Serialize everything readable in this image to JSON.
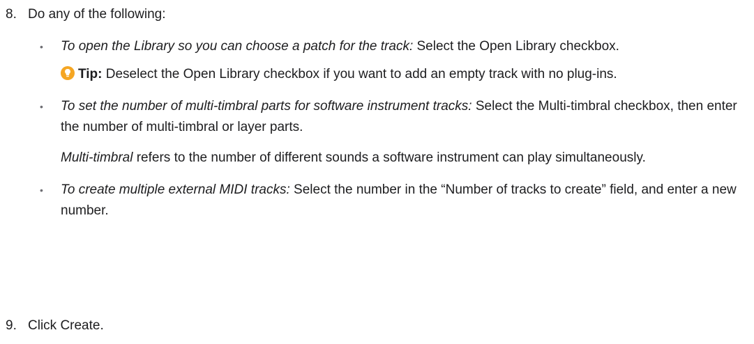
{
  "steps": {
    "step8": {
      "number": "8.",
      "text": "Do any of the following:"
    },
    "step9": {
      "number": "9.",
      "text": "Click Create."
    }
  },
  "bullets": [
    {
      "lead": "To open the Library so you can choose a patch for the track:",
      "text": " Select the Open Library checkbox.",
      "tip": {
        "icon": "lightbulb-icon",
        "label": "Tip:",
        "text": " Deselect the Open Library checkbox if you want to add an empty track with no plug-ins."
      }
    },
    {
      "lead": "To set the number of multi-timbral parts for software instrument tracks:",
      "text": " Select the Multi-timbral checkbox, then enter the number of multi-timbral or layer parts.",
      "note_italic": "Multi-timbral",
      "note_text": " refers to the number of different sounds a software instrument can play simultaneously."
    },
    {
      "lead": "To create multiple external MIDI tracks:",
      "text": " Select the number in the “Number of tracks to create” field, and enter a new number."
    }
  ],
  "colors": {
    "text": "#1d1d1f",
    "tip_icon": "#f5a623"
  }
}
